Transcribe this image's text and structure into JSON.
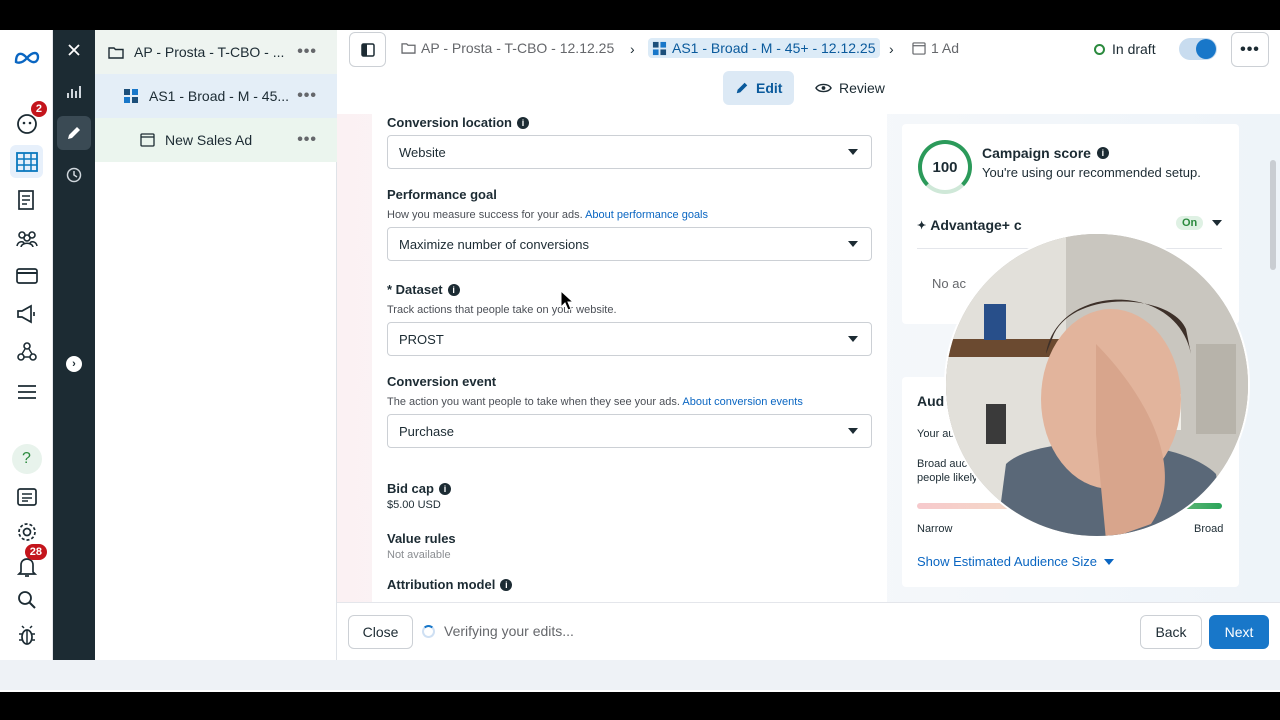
{
  "tree": {
    "campaign": "AP - Prosta - T-CBO - ...",
    "adset": "AS1 - Broad - M - 45...",
    "ad": "New Sales Ad"
  },
  "breadcrumb": {
    "campaign": "AP - Prosta - T-CBO - 12.12.25",
    "adset": "AS1 - Broad - M - 45+ - 12.12.25",
    "ad": "1 Ad",
    "status": "In draft"
  },
  "tabs": {
    "edit": "Edit",
    "review": "Review"
  },
  "form": {
    "conversion_location": {
      "label": "Conversion location",
      "value": "Website"
    },
    "performance_goal": {
      "label": "Performance goal",
      "hint": "How you measure success for your ads.",
      "link": "About performance goals",
      "value": "Maximize number of conversions"
    },
    "dataset": {
      "label": "* Dataset",
      "hint": "Track actions that people take on your website.",
      "value": "PROST"
    },
    "conversion_event": {
      "label": "Conversion event",
      "hint": "The action you want people to take when they see your ads.",
      "link": "About conversion events",
      "value": "Purchase"
    },
    "bid_cap": {
      "label": "Bid cap",
      "value": "$5.00 USD"
    },
    "value_rules": {
      "label": "Value rules",
      "value": "Not available"
    },
    "attribution_model": {
      "label": "Attribution model"
    }
  },
  "score_card": {
    "score": "100",
    "title": "Campaign score",
    "desc": "You're using our recommended setup.",
    "advantage": "Advantage+ c",
    "advantage_status": "On",
    "no_ads": "No ac"
  },
  "audience_card": {
    "title": "Aud",
    "your": "Your au",
    "broad_line1": "Broad auc",
    "broad_line2": "people likely",
    "narrow": "Narrow",
    "broad": "Broad",
    "link": "Show Estimated Audience Size"
  },
  "nav": {
    "notif_badge_1": "2",
    "notif_badge_2": "28"
  },
  "footer": {
    "close": "Close",
    "verifying": "Verifying your edits...",
    "back": "Back",
    "next": "Next"
  }
}
